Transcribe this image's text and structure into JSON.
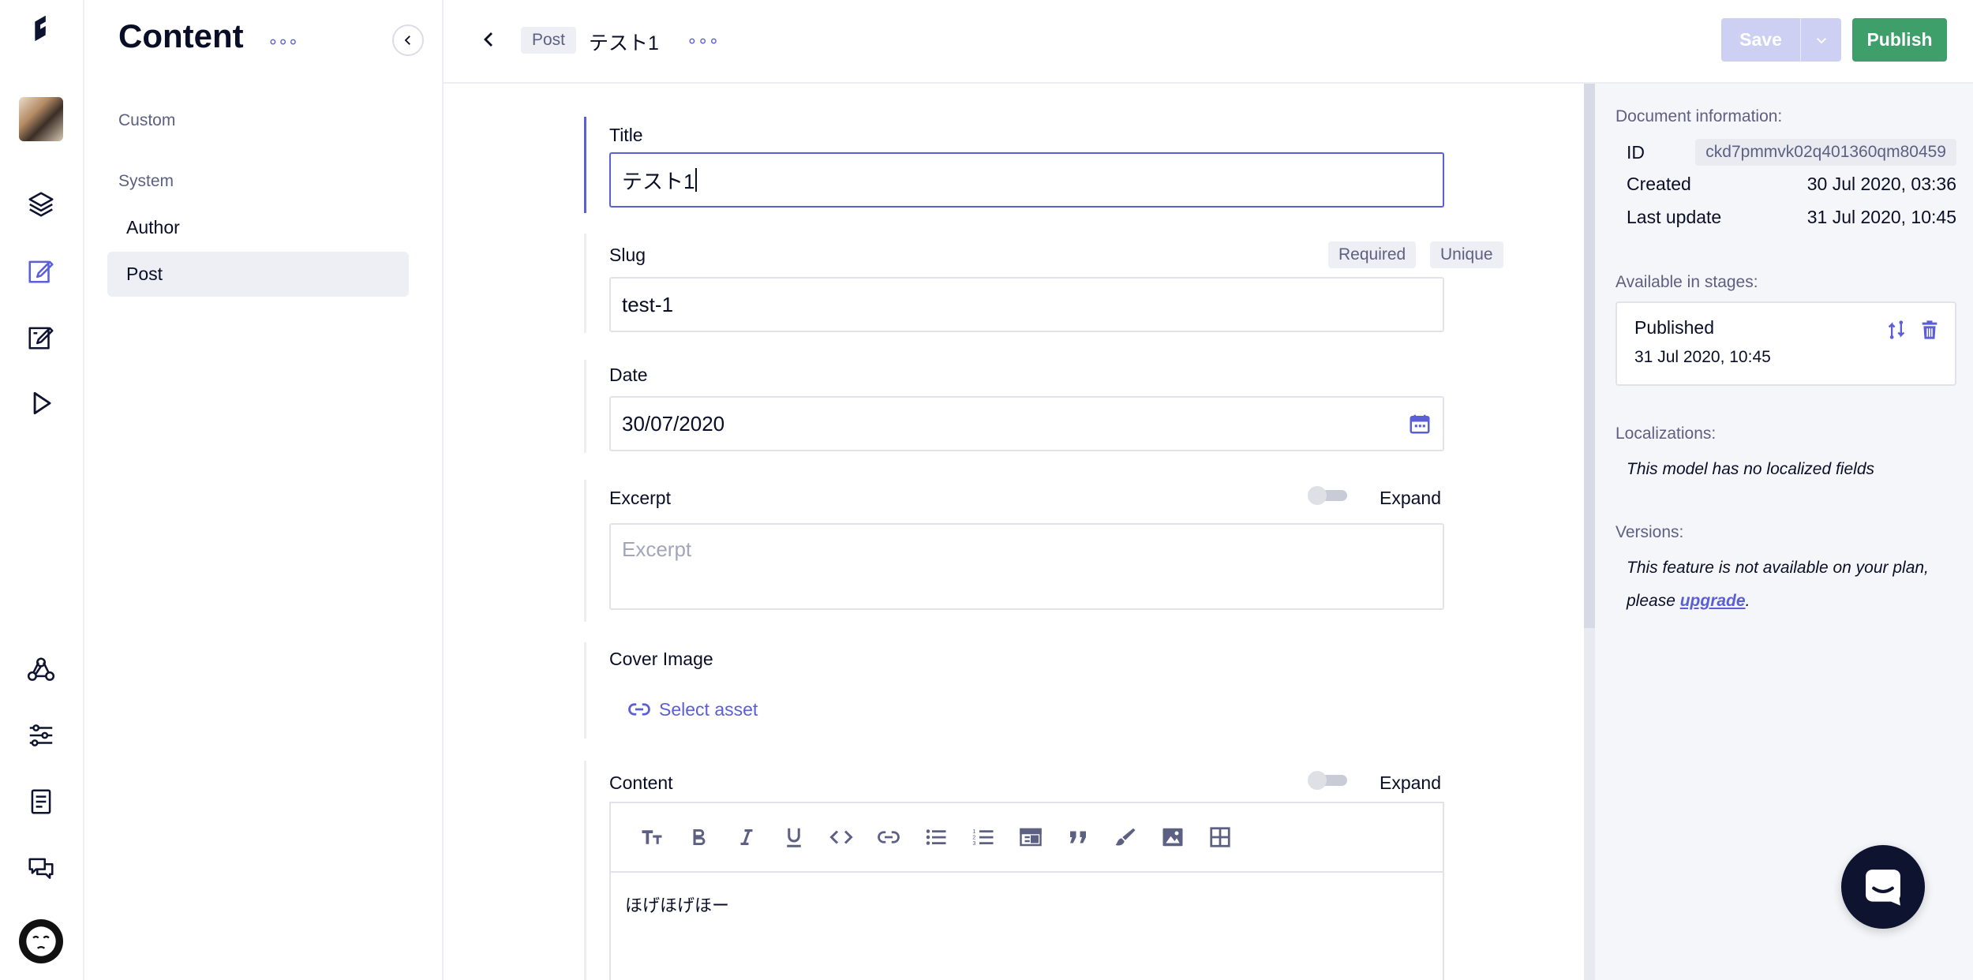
{
  "rail": {
    "icons": [
      "logo-icon",
      "project-thumbnail",
      "schema-icon",
      "content-icon",
      "content-alt-icon",
      "playground-icon",
      "webhooks-icon",
      "settings-icon",
      "docs-icon",
      "chat-icon",
      "avatar"
    ]
  },
  "sidebar": {
    "title": "Content",
    "more": "∘∘∘",
    "sections": [
      {
        "label": "Custom",
        "items": []
      },
      {
        "label": "System",
        "items": [
          {
            "label": "Author"
          },
          {
            "label": "Post",
            "active": true
          }
        ]
      }
    ]
  },
  "topbar": {
    "model_badge": "Post",
    "entry_title": "テスト1",
    "more": "∘∘∘",
    "save_label": "Save",
    "publish_label": "Publish"
  },
  "form": {
    "title": {
      "label": "Title",
      "value": "テスト1"
    },
    "slug": {
      "label": "Slug",
      "value": "test-1",
      "tags": [
        "Required",
        "Unique"
      ]
    },
    "date": {
      "label": "Date",
      "value": "30/07/2020"
    },
    "excerpt": {
      "label": "Excerpt",
      "placeholder": "Excerpt",
      "expand_label": "Expand"
    },
    "cover_image": {
      "label": "Cover Image",
      "select_asset_label": "Select asset"
    },
    "content": {
      "label": "Content",
      "expand_label": "Expand",
      "body": "ほげほげほー",
      "toolbar": [
        "heading-icon",
        "bold-icon",
        "italic-icon",
        "underline-icon",
        "code-icon",
        "link-icon",
        "bulleted-list-icon",
        "numbered-list-icon",
        "embed-icon",
        "quote-icon",
        "brush-icon",
        "image-icon",
        "table-icon"
      ]
    }
  },
  "doc_info": {
    "header": "Document information:",
    "id_label": "ID",
    "id_value": "ckd7pmmvk02q401360qm80459",
    "created_label": "Created",
    "created_value": "30 Jul 2020, 03:36",
    "updated_label": "Last update",
    "updated_value": "31 Jul 2020, 10:45"
  },
  "stages": {
    "header": "Available in stages:",
    "name": "Published",
    "date": "31 Jul 2020, 10:45"
  },
  "localizations": {
    "header": "Localizations:",
    "text": "This model has no localized fields"
  },
  "versions": {
    "header": "Versions:",
    "text_before": "This feature is not available on your plan, please ",
    "link": "upgrade",
    "text_after": "."
  },
  "colors": {
    "accent": "#5a5fd8",
    "publish": "#3e9f6a",
    "save_disabled": "#cdd0f3",
    "text": "#090e27",
    "muted": "#5c6082"
  }
}
